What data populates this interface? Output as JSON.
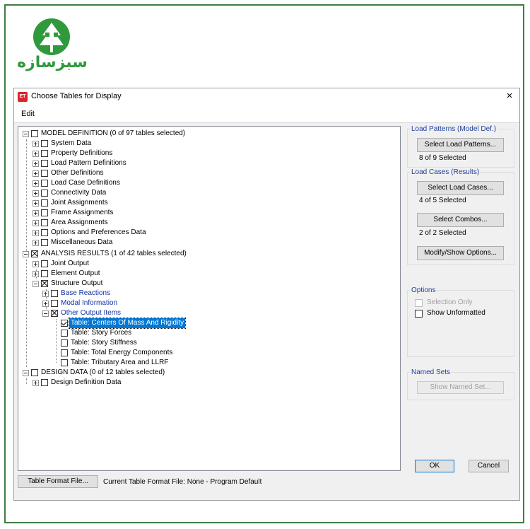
{
  "logo": {
    "text": "سبزسازه",
    "color": "#2f9a3c"
  },
  "dialog": {
    "title": "Choose Tables for Display",
    "app_icon": "ET",
    "close_label": "×"
  },
  "menu": {
    "edit": "Edit"
  },
  "tree": {
    "model_definition": "MODEL DEFINITION   (0 of 97 tables selected)",
    "model_children": [
      "System Data",
      "Property Definitions",
      "Load Pattern Definitions",
      "Other Definitions",
      "Load Case Definitions",
      "Connectivity Data",
      "Joint Assignments",
      "Frame Assignments",
      "Area Assignments",
      "Options and Preferences Data",
      "Miscellaneous Data"
    ],
    "analysis_results": "ANALYSIS RESULTS   (1 of 42 tables selected)",
    "joint_output": "Joint Output",
    "element_output": "Element Output",
    "structure_output": "Structure Output",
    "base_reactions": "Base Reactions",
    "modal_information": "Modal Information",
    "other_output_items": "Other Output Items",
    "tables": [
      "Table:  Centers Of Mass And Rigidity",
      "Table:  Story Forces",
      "Table:  Story Stiffness",
      "Table:  Total Energy Components",
      "Table:  Tributary Area and LLRF"
    ],
    "design_data": "DESIGN DATA   (0 of 12 tables selected)",
    "design_definition": "Design Definition Data"
  },
  "load_patterns": {
    "title": "Load Patterns (Model Def.)",
    "button": "Select Load Patterns...",
    "status": "8 of 9 Selected"
  },
  "load_cases": {
    "title": "Load Cases (Results)",
    "button": "Select Load Cases...",
    "status": "4 of 5 Selected",
    "combos_button": "Select Combos...",
    "combos_status": "2 of 2 Selected",
    "modify_button": "Modify/Show Options..."
  },
  "options": {
    "title": "Options",
    "selection_only": "Selection Only",
    "show_unformatted": "Show Unformatted"
  },
  "named_sets": {
    "title": "Named Sets",
    "button": "Show Named Set..."
  },
  "footer": {
    "table_format_button": "Table Format File...",
    "current_format": "Current Table Format File:  None - Program Default",
    "ok": "OK",
    "cancel": "Cancel"
  },
  "colors": {
    "accent": "#0078d7",
    "blue_text": "#1030a8",
    "group_title": "#1f3e9a",
    "frame": "#3e7d45"
  }
}
